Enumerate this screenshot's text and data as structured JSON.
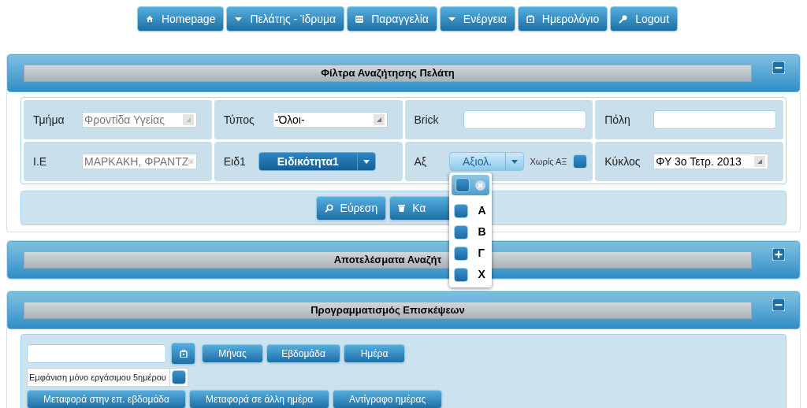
{
  "nav": [
    {
      "label": "Homepage"
    },
    {
      "label": "Πελάτης - Ίδρυμα"
    },
    {
      "label": "Παραγγελία"
    },
    {
      "label": "Ενέργεια"
    },
    {
      "label": "Ημερολόγιο"
    },
    {
      "label": "Logout"
    }
  ],
  "filters_panel": {
    "title": "Φίλτρα Αναζήτησης Πελάτη",
    "expanded": true,
    "cells": [
      {
        "kind": "select",
        "label": "Τμήμα",
        "value": "Φροντίδα Υγείας",
        "disabled": true
      },
      {
        "kind": "select",
        "label": "Τύπος",
        "value": "-Όλοι-",
        "disabled": false
      },
      {
        "kind": "input",
        "label": "Brick"
      },
      {
        "kind": "input",
        "label": "Πόλη"
      },
      {
        "kind": "select",
        "label": "Ι.Ε",
        "value": "ΜΑΡΚΑΚΗ, ΦΡΑΝΤΖ",
        "disabled": true
      },
      {
        "kind": "split",
        "label": "Ειδ1",
        "value": "Ειδικότητα1",
        "open": false
      },
      {
        "kind": "split",
        "label": "Αξ",
        "value": "Αξιολ.",
        "open": true,
        "checkbox": {
          "label": "Χωρίς ΑΞ",
          "checked": false
        },
        "menu": {
          "all_checked": false,
          "options": [
            {
              "label": "A",
              "checked": false
            },
            {
              "label": "B",
              "checked": false
            },
            {
              "label": "Γ",
              "checked": false
            },
            {
              "label": "X",
              "checked": false
            }
          ]
        }
      },
      {
        "kind": "select",
        "label": "Κύκλος",
        "value": "ΦΥ 3ο Τετρ. 2013",
        "disabled": false
      }
    ],
    "buttons": [
      {
        "label": "Εύρεση"
      },
      {
        "label": "Κα"
      }
    ]
  },
  "results_panel": {
    "title": "Αποτελέσματα Αναζήτ",
    "expanded": false
  },
  "schedule_panel": {
    "title": "Προγραμματισμός Επισκέψεων",
    "expanded": true,
    "views": [
      "Μήνας",
      "Εβδομάδα",
      "Ημέρα"
    ],
    "workweek": {
      "label": "Εμφάνιση μόνο εργάσιμου 5ημέρου",
      "checked": false
    },
    "actions": [
      "Μεταφορά στην επ. εβδομάδα",
      "Μεταφορά σε άλλη ημέρα",
      "Αντίγραφο ημέρας"
    ]
  }
}
